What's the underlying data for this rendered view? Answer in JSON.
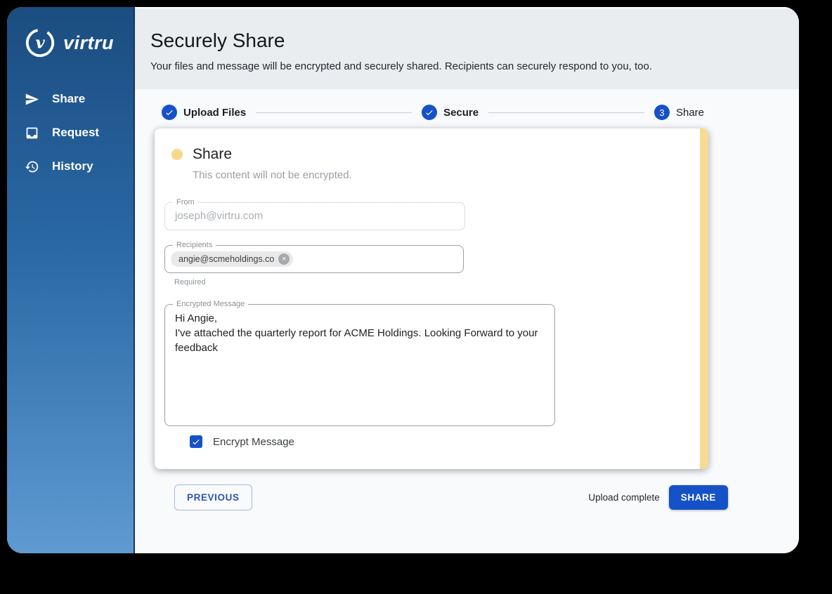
{
  "sidebar": {
    "logo_word": "virtru",
    "items": [
      {
        "label": "Share",
        "icon": "send-icon"
      },
      {
        "label": "Request",
        "icon": "inbox-icon"
      },
      {
        "label": "History",
        "icon": "history-icon"
      }
    ]
  },
  "header": {
    "title": "Securely Share",
    "subtitle": "Your files and message will be encrypted and securely shared. Recipients can securely respond to you, too."
  },
  "stepper": {
    "steps": [
      {
        "label": "Upload Files",
        "state": "completed"
      },
      {
        "label": "Secure",
        "state": "completed"
      },
      {
        "label": "Share",
        "state": "active",
        "number": "3"
      }
    ]
  },
  "card": {
    "title": "Share",
    "subtitle": "This content will not be encrypted.",
    "from": {
      "label": "From",
      "value": "joseph@virtru.com"
    },
    "recipients": {
      "label": "Recipients",
      "chip": "angie@scmeholdings.co",
      "chip_close": "×",
      "helper": "Required"
    },
    "message": {
      "label": "Encrypted Message",
      "lines": [
        "Hi Angie,",
        "I've attached the quarterly report for ACME Holdings. Looking Forward to your feedback"
      ]
    },
    "encrypt_checkbox": {
      "label": "Encrypt Message",
      "checked": true
    }
  },
  "footer": {
    "previous_label": "PREVIOUS",
    "status": "Upload complete",
    "share_label": "SHARE"
  },
  "colors": {
    "accent_blue": "#1552c8",
    "sidebar_top": "#1b4d80",
    "sidebar_bottom": "#5f9ad1",
    "warning_yellow": "#f6dc92",
    "header_bg": "#e9edf0"
  }
}
